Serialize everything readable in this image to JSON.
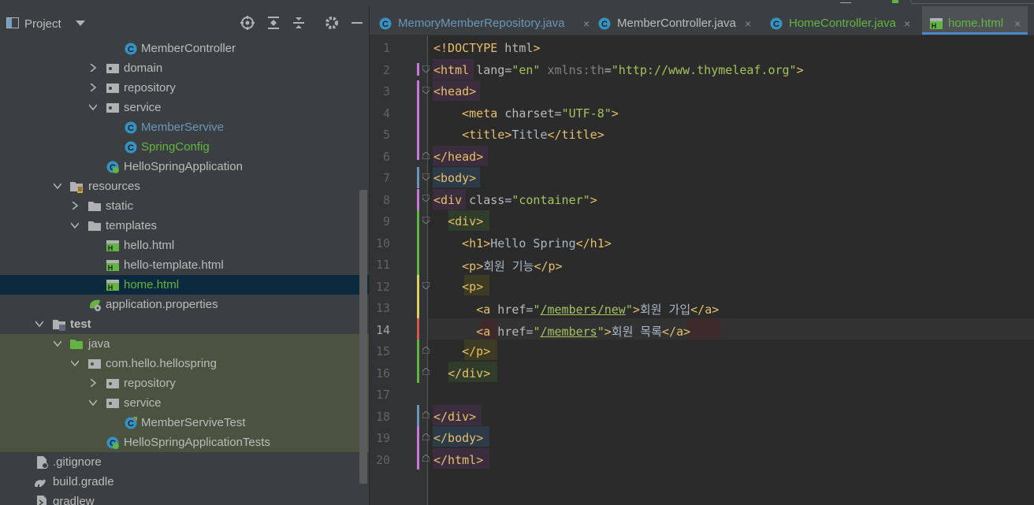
{
  "project_panel": {
    "title": "Project",
    "tree": [
      {
        "label": "MemberController",
        "style": "plain",
        "icon": "class-icon"
      },
      {
        "label": "domain",
        "style": "plain",
        "icon": "package-icon"
      },
      {
        "label": "repository",
        "style": "plain",
        "icon": "package-icon"
      },
      {
        "label": "service",
        "style": "plain",
        "icon": "package-icon"
      },
      {
        "label": "MemberServive",
        "style": "blue",
        "icon": "class-icon"
      },
      {
        "label": "SpringConfig",
        "style": "green",
        "icon": "class-icon"
      },
      {
        "label": "HelloSpringApplication",
        "style": "plain",
        "icon": "spring-boot-class-icon"
      },
      {
        "label": "resources",
        "style": "plain",
        "icon": "resources-folder-icon"
      },
      {
        "label": "static",
        "style": "plain",
        "icon": "folder-icon"
      },
      {
        "label": "templates",
        "style": "plain",
        "icon": "folder-icon"
      },
      {
        "label": "hello.html",
        "style": "plain",
        "icon": "html-file-icon"
      },
      {
        "label": "hello-template.html",
        "style": "plain",
        "icon": "html-file-icon"
      },
      {
        "label": "home.html",
        "style": "green",
        "icon": "html-file-icon"
      },
      {
        "label": "application.properties",
        "style": "plain",
        "icon": "properties-file-icon"
      },
      {
        "label": "test",
        "style": "bold",
        "icon": "test-folder-icon"
      },
      {
        "label": "java",
        "style": "plain",
        "icon": "test-source-folder-icon"
      },
      {
        "label": "com.hello.hellospring",
        "style": "plain",
        "icon": "package-icon"
      },
      {
        "label": "repository",
        "style": "plain",
        "icon": "package-icon"
      },
      {
        "label": "service",
        "style": "plain",
        "icon": "package-icon"
      },
      {
        "label": "MemberServiveTest",
        "style": "plain",
        "icon": "test-class-icon"
      },
      {
        "label": "HelloSpringApplicationTests",
        "style": "plain",
        "icon": "test-class-icon"
      },
      {
        "label": ".gitignore",
        "style": "plain",
        "icon": "gitignore-file-icon"
      },
      {
        "label": "build.gradle",
        "style": "plain",
        "icon": "gradle-file-icon"
      },
      {
        "label": "gradlew",
        "style": "plain",
        "icon": "file-icon"
      }
    ]
  },
  "tabs": [
    {
      "label": "MemoryMemberRepository.java",
      "color": "#6897bb",
      "close": "×"
    },
    {
      "label": "MemberController.java",
      "color": "#bbbbbb",
      "close": "×"
    },
    {
      "label": "HomeController.java",
      "color": "#62b543",
      "close": "×"
    },
    {
      "label": "home.html",
      "color": "#62b543",
      "close": "×"
    }
  ],
  "editor": {
    "current_line": 14,
    "line_numbers": [
      "1",
      "2",
      "3",
      "4",
      "5",
      "6",
      "7",
      "8",
      "9",
      "10",
      "11",
      "12",
      "13",
      "14",
      "15",
      "16",
      "17",
      "18",
      "19",
      "20"
    ],
    "lines": [
      "<!DOCTYPE html>",
      "<html lang=\"en\" xmlns:th=\"http://www.thymeleaf.org\">",
      "<head>",
      "    <meta charset=\"UTF-8\">",
      "    <title>Title</title>",
      "</head>",
      "<body>",
      "<div class=\"container\">",
      "  <div>",
      "    <h1>Hello Spring</h1>",
      "    <p>회원 기능</p>",
      "    <p>",
      "      <a href=\"/members/new\">회원 가입</a>",
      "      <a href=\"/members\">회원 목록</a>",
      "    </p>",
      "  </div>",
      "",
      "</div>",
      "</body>",
      "</html>"
    ]
  },
  "colors": {
    "tag": "#e8bf6a",
    "attr_value": "#a5c25c",
    "text": "#a9b7c6",
    "selection": "#0d293e",
    "test_highlight": "#4b5340"
  }
}
